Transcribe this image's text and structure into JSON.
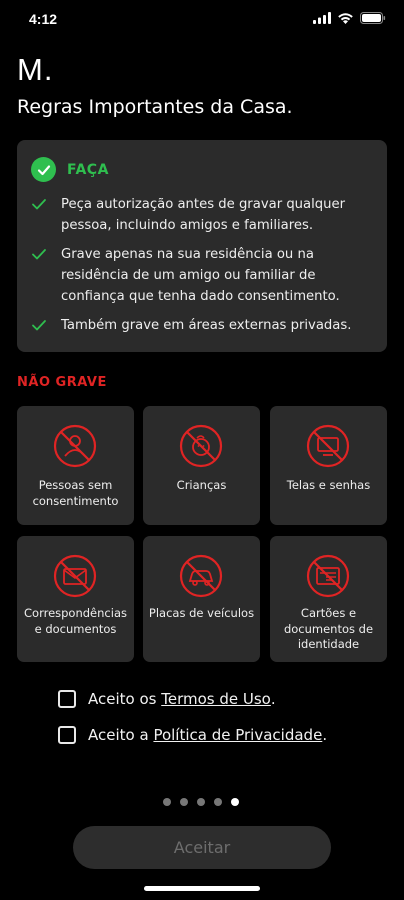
{
  "status": {
    "time": "4:12"
  },
  "app": {
    "logo": "M.",
    "title": "Regras Importantes da Casa."
  },
  "do_section": {
    "title": "FAÇA",
    "items": [
      "Peça autorização antes de gravar qualquer pessoa, incluindo amigos e familiares.",
      "Grave apenas na sua residência ou na residência de um amigo ou familiar de confiança que tenha dado consentimento.",
      "Também grave em áreas externas privadas."
    ]
  },
  "dont_section": {
    "title": "NÃO GRAVE",
    "tiles": [
      {
        "label": "Pessoas sem consentimento",
        "icon": "no-person-icon"
      },
      {
        "label": "Crianças",
        "icon": "no-child-icon"
      },
      {
        "label": "Telas e senhas",
        "icon": "no-screen-icon"
      },
      {
        "label": "Correspondências e documentos",
        "icon": "no-mail-icon"
      },
      {
        "label": "Placas de veículos",
        "icon": "no-vehicle-icon"
      },
      {
        "label": "Cartões e documentos de identidade",
        "icon": "no-id-card-icon"
      }
    ]
  },
  "consents": {
    "terms_prefix": "Aceito os ",
    "terms_link": "Termos de Uso",
    "terms_suffix": ".",
    "privacy_prefix": "Aceito a ",
    "privacy_link": "Política de Privacidade",
    "privacy_suffix": "."
  },
  "pagination": {
    "total": 5,
    "current": 5
  },
  "accept_button": "Aceitar",
  "colors": {
    "accent_green": "#2fbf4f",
    "accent_red": "#e02424",
    "card_bg": "#2b2b2b",
    "background": "#000000"
  }
}
